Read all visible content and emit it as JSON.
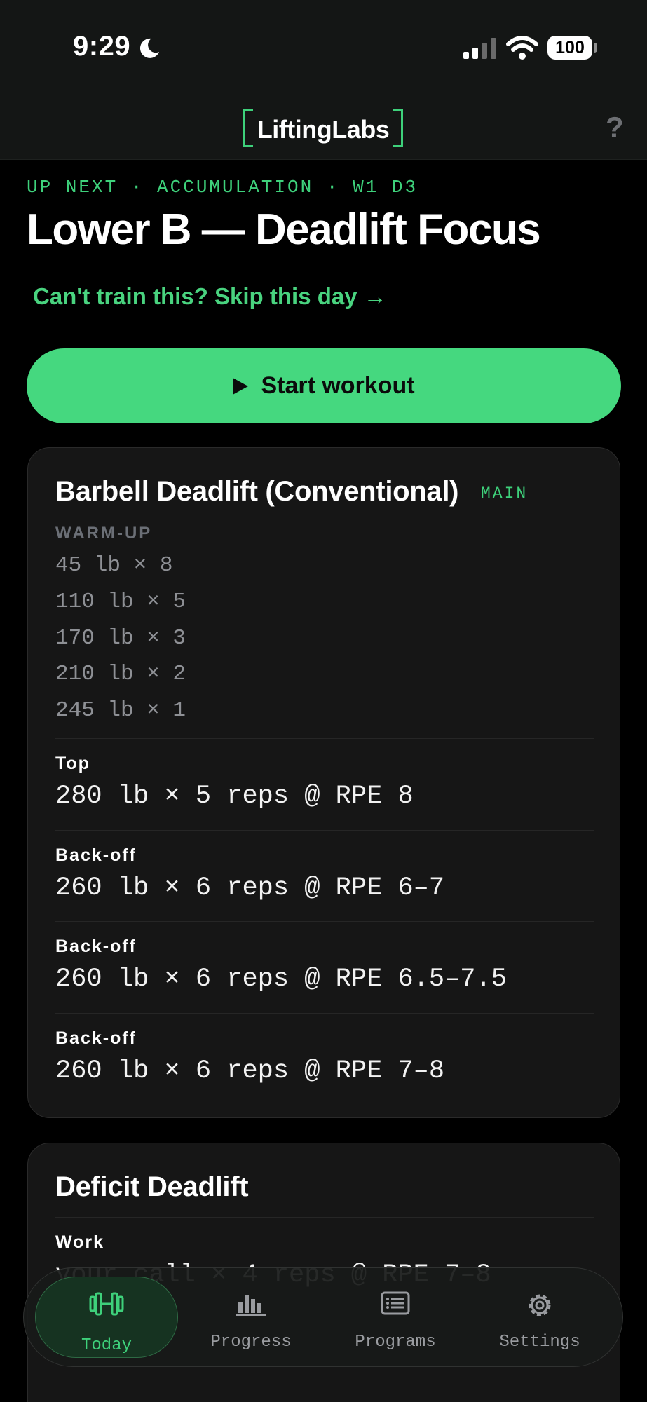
{
  "status_bar": {
    "time": "9:29",
    "battery": "100",
    "icons": [
      "moon-icon",
      "signal-icon",
      "wifi-icon",
      "battery-icon"
    ]
  },
  "header": {
    "logo": "LiftingLabs",
    "help": "?"
  },
  "workout": {
    "eyebrow": "UP NEXT · ACCUMULATION · W1 D3",
    "title": "Lower B — Deadlift Focus",
    "skip_link": "Can't train this? Skip this day →",
    "start_label": "Start workout"
  },
  "exercises": [
    {
      "name": "Barbell Deadlift (Conventional)",
      "badge": "MAIN",
      "warmup_label": "WARM-UP",
      "warmups": [
        "45 lb × 8",
        "110 lb × 5",
        "170 lb × 3",
        "210 lb × 2",
        "245 lb × 1"
      ],
      "sets": [
        {
          "label": "Top",
          "value": "280 lb × 5 reps @ RPE 8"
        },
        {
          "label": "Back-off",
          "value": "260 lb × 6 reps @ RPE 6–7"
        },
        {
          "label": "Back-off",
          "value": "260 lb × 6 reps @ RPE 6.5–7.5"
        },
        {
          "label": "Back-off",
          "value": "260 lb × 6 reps @ RPE 7–8"
        }
      ]
    },
    {
      "name": "Deficit Deadlift",
      "sets": [
        {
          "label": "Work",
          "value": "your call × 4 reps @ RPE 7–8"
        }
      ]
    }
  ],
  "tabs": [
    {
      "label": "Today",
      "icon": "dumbbell-icon",
      "active": true
    },
    {
      "label": "Progress",
      "icon": "bar-chart-icon",
      "active": false
    },
    {
      "label": "Programs",
      "icon": "list-icon",
      "active": false
    },
    {
      "label": "Settings",
      "icon": "gear-icon",
      "active": false
    }
  ],
  "colors": {
    "accent": "#45d87f",
    "background": "#000000",
    "card": "#161616"
  }
}
